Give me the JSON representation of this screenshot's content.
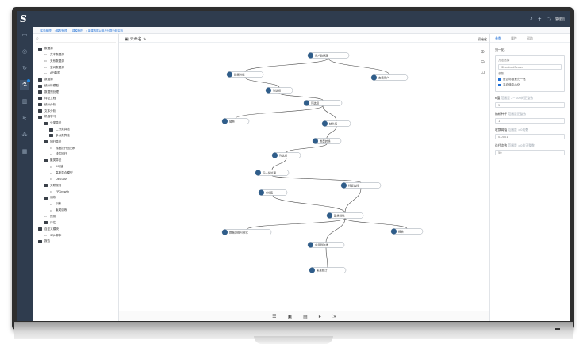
{
  "app": {
    "logo": "S",
    "user_name": "管理员"
  },
  "breadcrumb": [
    "实验管理",
    "模型管理",
    "建模管理",
    "新建数据以用户分群分析实验"
  ],
  "canvas": {
    "title": "未命名",
    "init_label": "初始化",
    "tools": [
      "zoom-in-icon",
      "zoom-out-icon",
      "fit-icon"
    ]
  },
  "tree": [
    {
      "label": "数据源",
      "lvl": 0,
      "type": "folder"
    },
    {
      "label": "文本数据源",
      "lvl": 1,
      "type": "leaf"
    },
    {
      "label": "关系数据源",
      "lvl": 1,
      "type": "leaf"
    },
    {
      "label": "空间数据源",
      "lvl": 1,
      "type": "leaf"
    },
    {
      "label": "API数据",
      "lvl": 1,
      "type": "leaf"
    },
    {
      "label": "数据源",
      "lvl": 0,
      "type": "folder"
    },
    {
      "label": "统计标模型",
      "lvl": 0,
      "type": "folder"
    },
    {
      "label": "数据预处理",
      "lvl": 0,
      "type": "folder"
    },
    {
      "label": "特征工程",
      "lvl": 0,
      "type": "folder"
    },
    {
      "label": "统计分析",
      "lvl": 0,
      "type": "folder"
    },
    {
      "label": "文本分析",
      "lvl": 0,
      "type": "folder"
    },
    {
      "label": "机器学习",
      "lvl": 0,
      "type": "folder"
    },
    {
      "label": "分类算法",
      "lvl": 1,
      "type": "folder"
    },
    {
      "label": "二分类算法",
      "lvl": 2,
      "type": "folder"
    },
    {
      "label": "多分类算法",
      "lvl": 2,
      "type": "folder"
    },
    {
      "label": "回归算法",
      "lvl": 1,
      "type": "folder"
    },
    {
      "label": "梯度提升回归树",
      "lvl": 2,
      "type": "leaf"
    },
    {
      "label": "线性回归",
      "lvl": 2,
      "type": "leaf"
    },
    {
      "label": "聚类算法",
      "lvl": 1,
      "type": "folder"
    },
    {
      "label": "K均值",
      "lvl": 2,
      "type": "leaf"
    },
    {
      "label": "高斯混合模型",
      "lvl": 2,
      "type": "leaf"
    },
    {
      "label": "DBSCAN",
      "lvl": 2,
      "type": "leaf"
    },
    {
      "label": "关联规则",
      "lvl": 1,
      "type": "folder"
    },
    {
      "label": "FPGrowth",
      "lvl": 2,
      "type": "leaf"
    },
    {
      "label": "训练",
      "lvl": 1,
      "type": "folder"
    },
    {
      "label": "训练",
      "lvl": 2,
      "type": "leaf"
    },
    {
      "label": "聚类训练",
      "lvl": 2,
      "type": "leaf"
    },
    {
      "label": "预测",
      "lvl": 1,
      "type": "leaf"
    },
    {
      "label": "评估",
      "lvl": 1,
      "type": "folder"
    },
    {
      "label": "自定义模块",
      "lvl": 0,
      "type": "folder"
    },
    {
      "label": "SQL脚本",
      "lvl": 1,
      "type": "leaf"
    },
    {
      "label": "报告",
      "lvl": 0,
      "type": "folder"
    }
  ],
  "flow": {
    "nodes": [
      {
        "id": "n1",
        "label": "用户数据源"
      },
      {
        "id": "n2",
        "label": "数据分组"
      },
      {
        "id": "n3",
        "label": "查看用户"
      },
      {
        "id": "n4",
        "label": "列选择"
      },
      {
        "id": "n5",
        "label": "列选择"
      },
      {
        "id": "n6",
        "label": "替换"
      },
      {
        "id": "n7",
        "label": "缺失值"
      },
      {
        "id": "n8",
        "label": "类型转换"
      },
      {
        "id": "n9",
        "label": "列选择"
      },
      {
        "id": "n10",
        "label": "归一化处理"
      },
      {
        "id": "n11",
        "label": "特征选择"
      },
      {
        "id": "n12",
        "label": "K均值"
      },
      {
        "id": "n13",
        "label": "聚类训练"
      },
      {
        "id": "n14",
        "label": "数据分群可视化"
      },
      {
        "id": "n15",
        "label": "报告"
      },
      {
        "id": "n16",
        "label": "应用到聚类"
      },
      {
        "id": "n17",
        "label": "未来统计"
      }
    ]
  },
  "panel": {
    "tabs": [
      "参数",
      "属性",
      "帮助"
    ],
    "section": "归一化",
    "method_label": "方法选择",
    "method_value": "StandardScaler",
    "params_label": "参数",
    "check1": "是否标准差归一化",
    "check2": "平均值中心化",
    "field1_label": "K值",
    "field1_hint": "范围是 2~100的正整数",
    "field1_value": "5",
    "field2_label": "随机种子",
    "field2_hint": "范围是正整数",
    "field2_value": "1",
    "field3_label": "收敛阈值",
    "field3_hint": "范围是 >0的数",
    "field3_value": "0.0001",
    "field4_label": "迭代次数",
    "field4_hint": "范围是 >0的正整数",
    "field4_value": "50"
  },
  "colors": {
    "topbar": "#2f3c4e",
    "accent": "#1f6fd6",
    "node_icon": "#2f5d8a"
  }
}
